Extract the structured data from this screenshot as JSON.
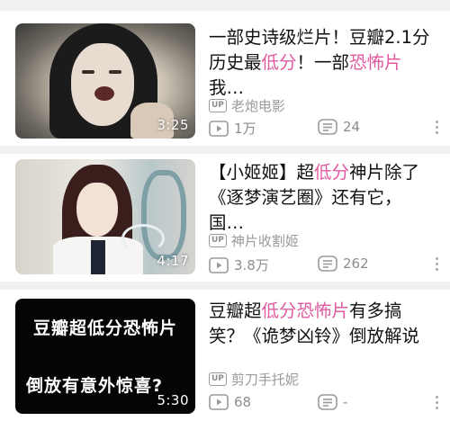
{
  "feed": [
    {
      "duration": "3:25",
      "title_parts": [
        {
          "text": "一部史诗级烂片！豆瓣2.1分历史最",
          "hl": false
        },
        {
          "text": "低分",
          "hl": true
        },
        {
          "text": "！一部",
          "hl": false
        },
        {
          "text": "恐怖片",
          "hl": true
        },
        {
          "text": "我…",
          "hl": false
        }
      ],
      "up_badge": "UP",
      "uploader": "老炮电影",
      "plays": "1万",
      "comments": "24"
    },
    {
      "duration": "4:17",
      "title_parts": [
        {
          "text": "【小姬姬】超",
          "hl": false
        },
        {
          "text": "低分",
          "hl": true
        },
        {
          "text": "神片除了《逐梦演艺圈》还有它，国…",
          "hl": false
        }
      ],
      "up_badge": "UP",
      "uploader": "神片收割姬",
      "plays": "3.8万",
      "comments": "262"
    },
    {
      "duration": "5:30",
      "thumb_caption_1": "豆瓣超低分恐怖片",
      "thumb_caption_2": "倒放有意外惊喜?",
      "title_parts": [
        {
          "text": "豆瓣超",
          "hl": false
        },
        {
          "text": "低分恐怖片",
          "hl": true
        },
        {
          "text": "有多搞笑？《诡梦凶铃》倒放解说",
          "hl": false
        }
      ],
      "up_badge": "UP",
      "uploader": "剪刀手托妮",
      "plays": "68",
      "comments": "-"
    }
  ],
  "colors": {
    "highlight": "#e05aa0",
    "meta_gray": "#8d8d8d",
    "separator": "#f1f1f1"
  },
  "icons": {
    "play_count": "play-count-icon",
    "comment_count": "comment-count-icon",
    "more": "more-options-icon"
  }
}
